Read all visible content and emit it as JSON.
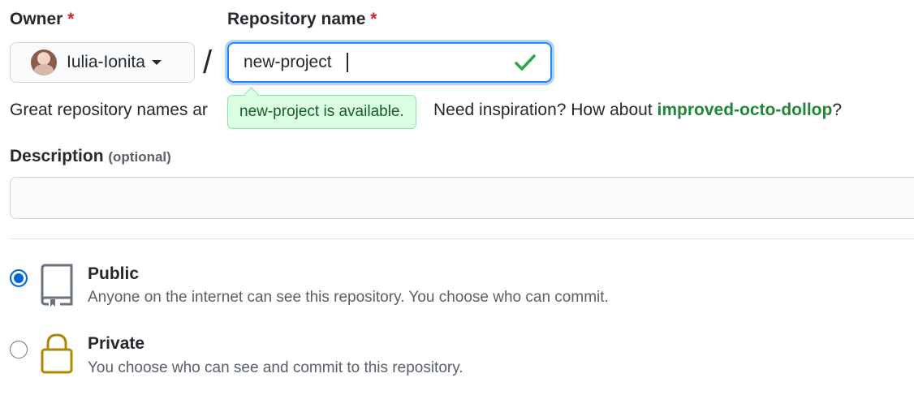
{
  "owner": {
    "label": "Owner",
    "required_mark": "*",
    "selected": "Iulia-Ionita"
  },
  "repo": {
    "label": "Repository name",
    "required_mark": "*",
    "value": "new-project",
    "valid": true
  },
  "separator": "/",
  "availability_tooltip": "new-project is available.",
  "help": {
    "text_before": "Great repository names ar",
    "text_after": "Need inspiration? How about ",
    "suggestion": "improved-octo-dollop",
    "text_end": "?"
  },
  "description": {
    "label": "Description",
    "optional": "(optional)",
    "value": ""
  },
  "visibility": {
    "options": [
      {
        "title": "Public",
        "description": "Anyone on the internet can see this repository. You choose who can commit.",
        "selected": true
      },
      {
        "title": "Private",
        "description": "You choose who can see and commit to this repository.",
        "selected": false
      }
    ]
  },
  "colors": {
    "accent": "#0366d6",
    "success": "#28a745",
    "suggestion": "#22863a",
    "required": "#cb2431",
    "private_icon": "#b08800"
  }
}
